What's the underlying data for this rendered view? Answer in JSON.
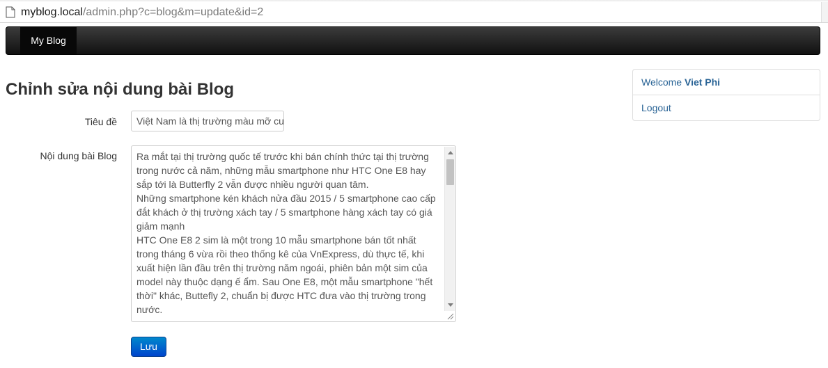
{
  "browser": {
    "url_host": "myblog.local",
    "url_path": "/admin.php?c=blog&m=update&id=2"
  },
  "navbar": {
    "brand": "My Blog"
  },
  "page": {
    "title": "Chỉnh sửa nội dung bài Blog"
  },
  "form": {
    "title_label": "Tiêu đề",
    "title_value": "Việt Nam là thị trường màu mỡ cu",
    "content_label": "Nội dung bài Blog",
    "content_value": "Ra mắt tại thị trường quốc tế trước khi bán chính thức tại thị trường\ntrong nước cả năm, những mẫu smartphone như HTC One E8 hay\nsắp tới là Butterfly 2 vẫn được nhiều người quan tâm.\nNhững smartphone kén khách nửa đầu 2015 / 5 smartphone cao cấp\nđắt khách ở thị trường xách tay / 5 smartphone hàng xách tay có giá\ngiảm mạnh\nHTC One E8 2 sim là một trong 10 mẫu smartphone bán tốt nhất\ntrong tháng 6 vừa rồi theo thống kê của VnExpress, dù thực tế, khi\nxuất hiện lần đầu trên thị trường năm ngoái, phiên bản một sim của\nmodel này thuộc dạng ế ẩm. Sau One E8, một mẫu smartphone \"hết\nthời\" khác, Buttefly 2, chuẩn bị được HTC đưa vào thị trường trong\nnước.",
    "save_label": "Lưu"
  },
  "sidebar": {
    "welcome_prefix": "Welcome",
    "username": "Viet Phi",
    "logout_label": "Logout"
  },
  "colors": {
    "navbar": "#1b1b1b",
    "button": "#0066cc",
    "link": "#2a6496"
  },
  "icons": {
    "page": "page-icon"
  }
}
